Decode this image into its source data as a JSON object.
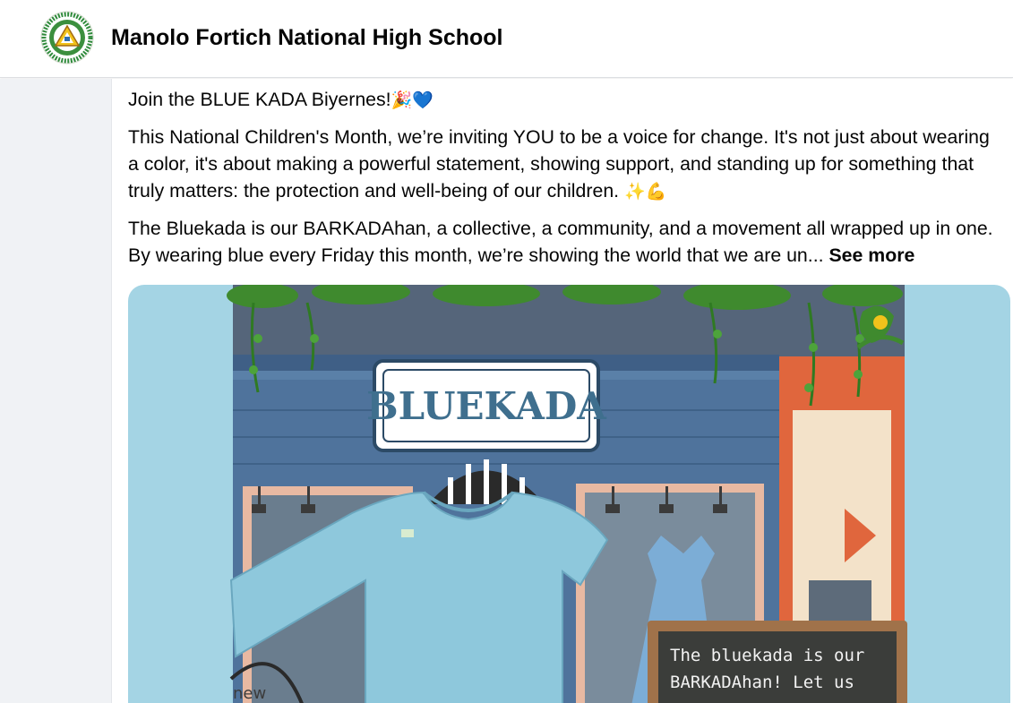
{
  "header": {
    "page_name": "Manolo Fortich National High School",
    "logo_icon": "school-seal-logo"
  },
  "post": {
    "paragraph1": "Join the BLUE KADA Biyernes!",
    "paragraph1_emojis": "🎉💙",
    "paragraph2": "This National Children's Month, we’re inviting YOU to be a voice for change. It's not just about wearing a color, it's about making a powerful statement, showing support, and standing up for something that truly matters: the protection and well-being of our children.",
    "paragraph2_emojis": "✨💪",
    "paragraph3": "The Bluekada is our BARKADAhan, a collective, a community, and a movement all wrapped up in one. By wearing blue every Friday this month, we’re showing the world that we are un...",
    "see_more": "See more"
  },
  "image": {
    "sign_text": "BLUEKADA",
    "chalkboard_line1": "The bluekada is our",
    "chalkboard_line2": "BARKADAhan! Let us",
    "tag_text": "new"
  },
  "colors": {
    "media_bg": "#a4d4e4",
    "store_wall": "#4d6d93",
    "shirt": "#8ec8dc",
    "sign_text": "#3f6f8e"
  }
}
